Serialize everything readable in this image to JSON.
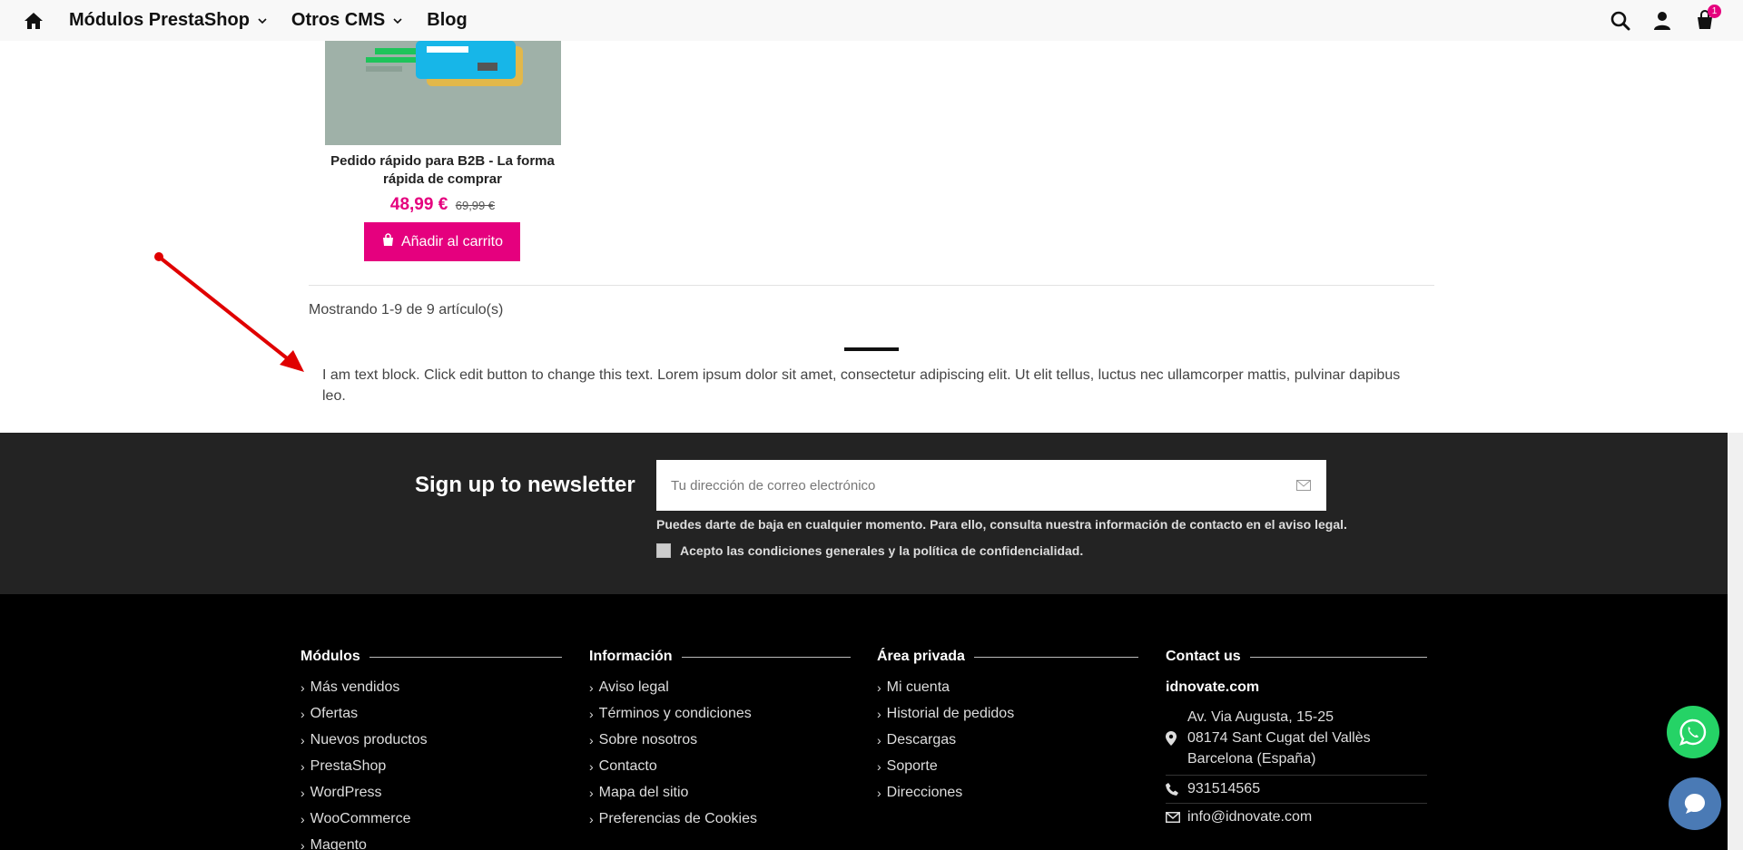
{
  "header": {
    "nav": [
      {
        "label": "Módulos PrestaShop",
        "has_dropdown": true
      },
      {
        "label": "Otros CMS",
        "has_dropdown": true
      },
      {
        "label": "Blog",
        "has_dropdown": false
      }
    ],
    "icons": [
      "home-icon",
      "search-icon",
      "user-icon",
      "cart-icon"
    ],
    "cart_count": "1"
  },
  "product": {
    "name": "Pedido rápido para B2B - La forma rápida de comprar",
    "price": "48,99 €",
    "old_price": "69,99 €",
    "add_to_cart_label": "Añadir al carrito"
  },
  "listing": {
    "showing": "Mostrando 1-9 de 9 artículo(s)"
  },
  "text_block": "I am text block. Click edit button to change this text. Lorem ipsum dolor sit amet, consectetur adipiscing elit. Ut elit tellus, luctus nec ullamcorper mattis, pulvinar dapibus leo.",
  "newsletter": {
    "title": "Sign up to newsletter",
    "placeholder": "Tu dirección de correo electrónico",
    "note": "Puedes darte de baja en cualquier momento. Para ello, consulta nuestra información de contacto en el aviso legal.",
    "consent": "Acepto las condiciones generales y la política de confidencialidad."
  },
  "footer": {
    "modulos": {
      "title": "Módulos",
      "items": [
        "Más vendidos",
        "Ofertas",
        "Nuevos productos",
        "PrestaShop",
        "WordPress",
        "WooCommerce",
        "Magento"
      ]
    },
    "informacion": {
      "title": "Información",
      "items": [
        "Aviso legal",
        "Términos y condiciones",
        "Sobre nosotros",
        "Contacto",
        "Mapa del sitio",
        "Preferencias de Cookies"
      ]
    },
    "area_privada": {
      "title": "Área privada",
      "items": [
        "Mi cuenta",
        "Historial de pedidos",
        "Descargas",
        "Soporte",
        "Direcciones"
      ]
    },
    "contact": {
      "title": "Contact us",
      "site": "idnovate.com",
      "address_line1": "Av. Via Augusta, 15-25",
      "address_line2": "08174 Sant Cugat del Vallès",
      "address_line3": "Barcelona (España)",
      "phone": "931514565",
      "email": "info@idnovate.com"
    }
  },
  "colors": {
    "accent": "#e5007e",
    "newsletter_bg": "#232323",
    "footer_bg": "#000000",
    "whatsapp": "#25d366",
    "chat": "#4a7ab5",
    "annotation_arrow": "#e00000"
  }
}
